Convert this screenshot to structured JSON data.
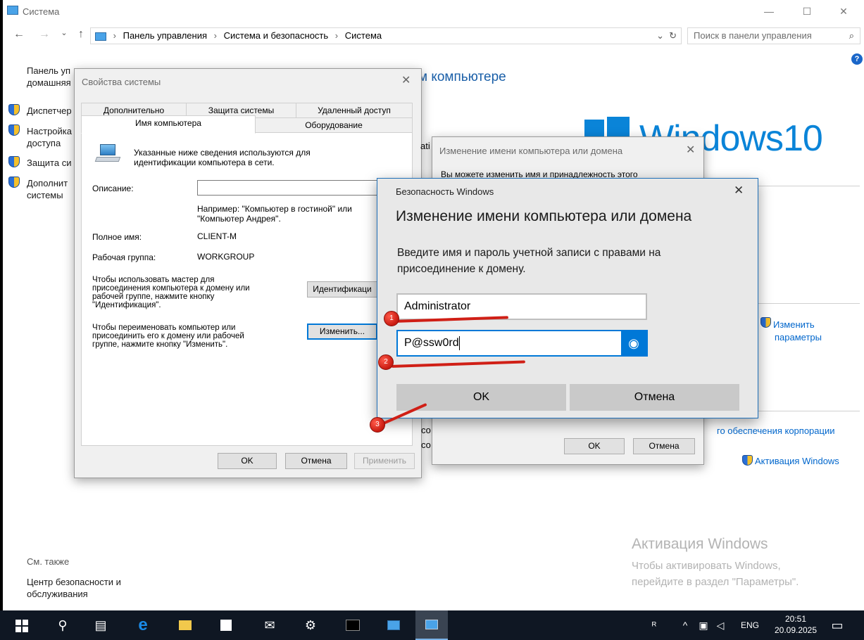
{
  "window": {
    "title": "Система",
    "controls": [
      "—",
      "☐",
      "✕"
    ],
    "breadcrumb": [
      "Панель управления",
      "Система и безопасность",
      "Система"
    ],
    "search_placeholder": "Поиск в панели управления",
    "help_icon": "?"
  },
  "sidebar": {
    "home_label": "Панель управления — домашняя страница",
    "home_line1": "Панель уп",
    "home_line2": "домашняя",
    "items": [
      {
        "label": "Диспетчер",
        "icon": "shield-icon"
      },
      {
        "label": "Настройка",
        "label2": "доступа",
        "icon": "shield-icon"
      },
      {
        "label": "Защита си",
        "icon": "shield-icon"
      },
      {
        "label": "Дополнит",
        "label2": "системы",
        "icon": "shield-icon"
      }
    ],
    "see_also": "См. также",
    "security_center_1": "Центр безопасности и",
    "security_center_2": "обслуживания"
  },
  "main": {
    "heading_partial": "м компьютере",
    "logo_text": "Windows10",
    "fragment_ati": "ati",
    "fragment_co1": "со",
    "fragment_co2": "со",
    "change_params_1": "Изменить",
    "change_params_2": "параметры",
    "corp_support": "го обеспечения корпорации",
    "activation_link": "Активация Windows",
    "watermark_title": "Активация Windows",
    "watermark_line1": "Чтобы активировать Windows,",
    "watermark_line2": "перейдите в раздел \"Параметры\"."
  },
  "sysprops": {
    "title": "Свойства системы",
    "tabs_row1": [
      "Дополнительно",
      "Защита системы",
      "Удаленный доступ"
    ],
    "tabs_row2": [
      "Имя компьютера",
      "Оборудование"
    ],
    "info_line1": "Указанные ниже сведения используются для",
    "info_line2": "идентификации компьютера в сети.",
    "description_label": "Описание:",
    "description_value": "",
    "example_line1": "Например: \"Компьютер в гостиной\" или",
    "example_line2": "\"Компьютер Андрея\".",
    "fullname_label": "Полное имя:",
    "fullname_value": "CLIENT-M",
    "workgroup_label": "Рабочая группа:",
    "workgroup_value": "WORKGROUP",
    "wizard_text": [
      "Чтобы использовать мастер для",
      "присоединения компьютера к домену или",
      "рабочей группе, нажмите кнопку",
      "\"Идентификация\"."
    ],
    "rename_text": [
      "Чтобы переименовать компьютер или",
      "присоединить его к домену или рабочей",
      "группе, нажмите кнопку \"Изменить\"."
    ],
    "ident_button": "Идентификаци",
    "change_button": "Изменить...",
    "ok": "OK",
    "cancel": "Отмена",
    "apply": "Применить"
  },
  "rename_dialog": {
    "title": "Изменение имени компьютера или домена",
    "partial_text": "Вы можете изменить имя и принадлежность этого",
    "ok": "OK",
    "cancel": "Отмена"
  },
  "security_dialog": {
    "title": "Безопасность Windows",
    "heading": "Изменение имени компьютера или домена",
    "prompt_line1": "Введите имя и пароль учетной записи с правами на",
    "prompt_line2": "присоединение к домену.",
    "username_value": "Administrator",
    "password_value": "P@ssw0rd",
    "ok": "OK",
    "cancel": "Отмена"
  },
  "annotations": [
    {
      "label": "1"
    },
    {
      "label": "2"
    },
    {
      "label": "3"
    }
  ],
  "taskbar": {
    "lang": "ENG",
    "time": "20:51",
    "date": "20.09.2025",
    "icons": [
      "start-icon",
      "search-icon",
      "task-view-icon",
      "edge-icon",
      "explorer-icon",
      "store-icon",
      "mail-icon",
      "settings-icon",
      "cmd-icon",
      "control-panel-icon",
      "system-icon"
    ]
  },
  "colors": {
    "accent": "#0078d7",
    "link": "#0066cc",
    "marker_red": "#d01f16",
    "taskbar": "#0f1723"
  }
}
